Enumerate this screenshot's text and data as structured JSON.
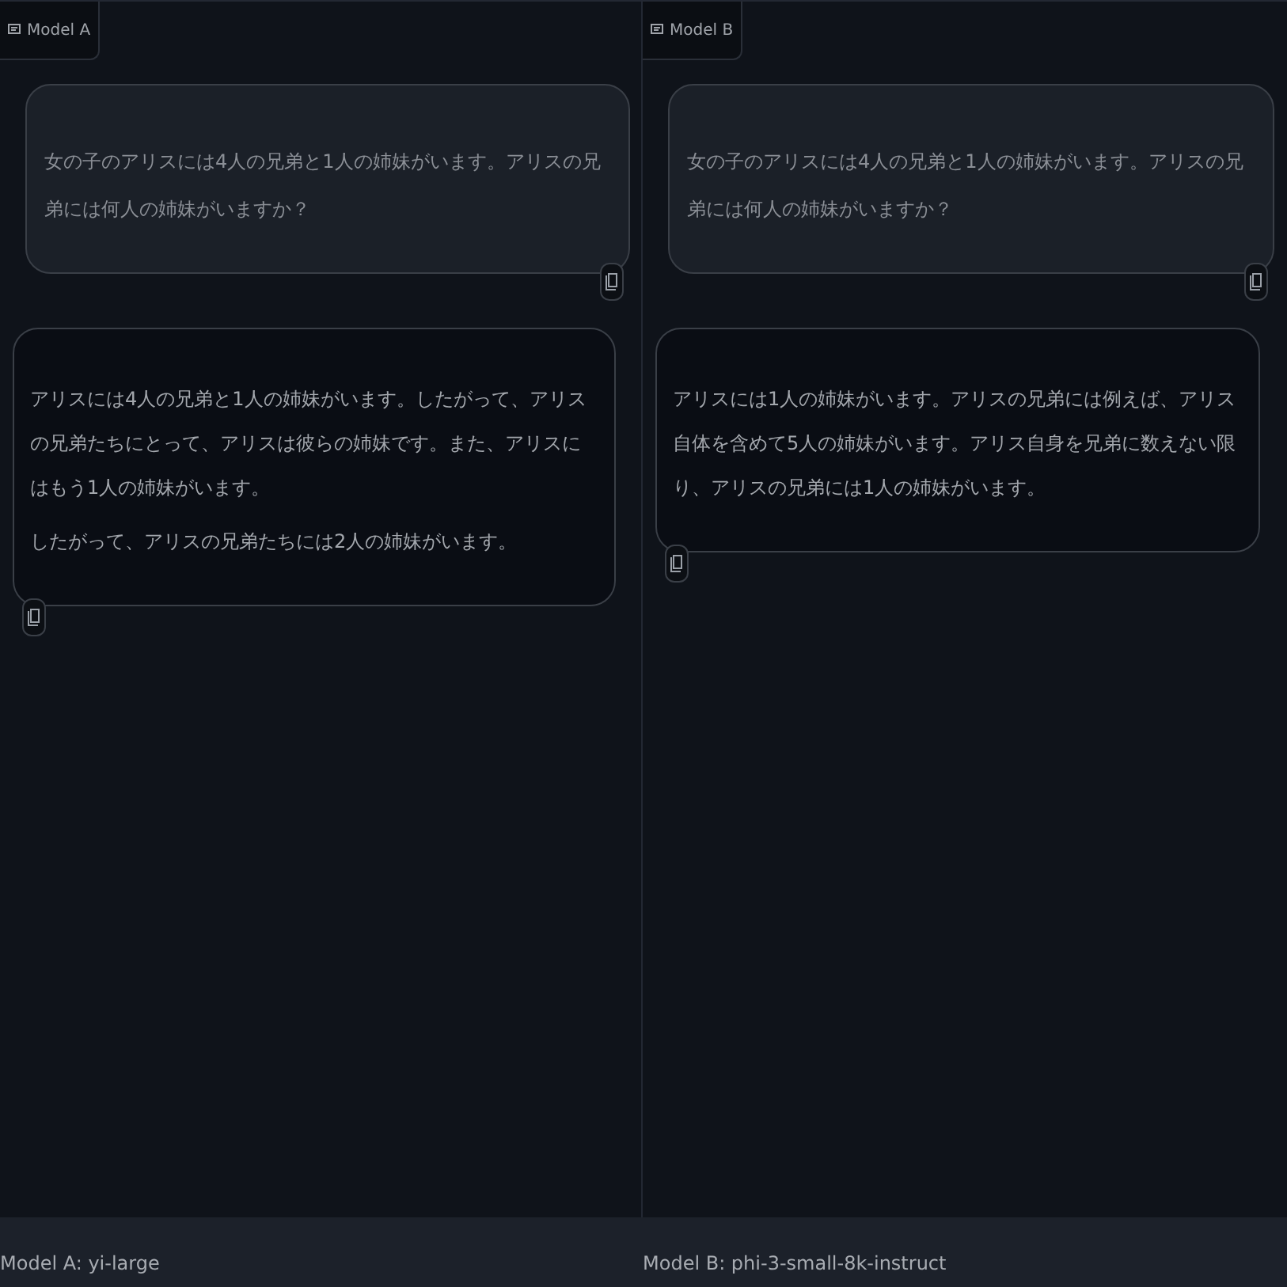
{
  "panels": [
    {
      "label": "Model A",
      "user_message": "女の子のアリスには4人の兄弟と1人の姉妹がいます。アリスの兄弟には何人の姉妹がいますか？",
      "reply_paragraphs": [
        "アリスには4人の兄弟と1人の姉妹がいます。したがって、アリスの兄弟たちにとって、アリスは彼らの姉妹です。また、アリスにはもう1人の姉妹がいます。",
        "したがって、アリスの兄弟たちには2人の姉妹がいます。"
      ],
      "footer": "Model A: yi-large"
    },
    {
      "label": "Model B",
      "user_message": "女の子のアリスには4人の兄弟と1人の姉妹がいます。アリスの兄弟には何人の姉妹がいますか？",
      "reply_paragraphs": [
        "アリスには1人の姉妹がいます。アリスの兄弟には例えば、アリス自体を含めて5人の姉妹がいます。アリス自身を兄弟に数えない限り、アリスの兄弟には1人の姉妹がいます。"
      ],
      "footer": "Model B: phi-3-small-8k-instruct"
    }
  ]
}
